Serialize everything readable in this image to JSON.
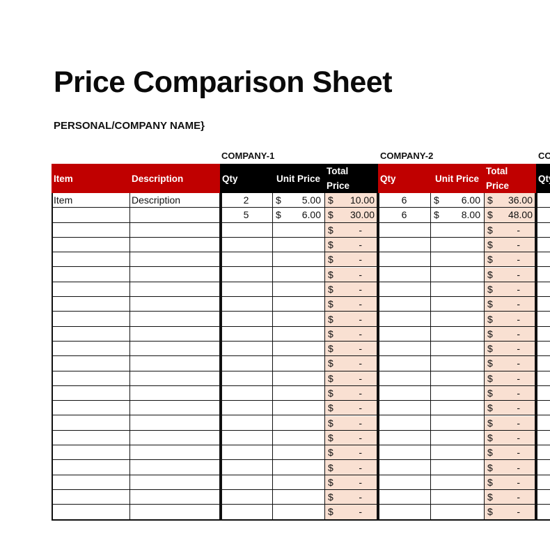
{
  "document": {
    "title": "Price Comparison Sheet",
    "subtitle": "PERSONAL/COMPANY NAME}"
  },
  "columns": {
    "item": "Item",
    "description": "Description",
    "qty": "Qty",
    "unit_price": "Unit Price",
    "total_price_line1": "Total",
    "total_price_line2": "Price"
  },
  "companies": [
    {
      "name": "COMPANY-1",
      "header_color": "#000000"
    },
    {
      "name": "COMPANY-2",
      "header_color": "#c00000"
    },
    {
      "name": "CO",
      "header_color": "#000000"
    }
  ],
  "colors": {
    "accent_red": "#c00000",
    "header_black": "#000000",
    "total_fill": "#f9e0d2"
  },
  "currency_symbol": "$",
  "empty_total": "-",
  "rows": [
    {
      "item": "Item",
      "description": "Description",
      "c1": {
        "qty": "2",
        "unit_price": "5.00",
        "total": "10.00"
      },
      "c2": {
        "qty": "6",
        "unit_price": "6.00",
        "total": "36.00"
      }
    },
    {
      "item": "",
      "description": "",
      "c1": {
        "qty": "5",
        "unit_price": "6.00",
        "total": "30.00"
      },
      "c2": {
        "qty": "6",
        "unit_price": "8.00",
        "total": "48.00"
      }
    },
    {
      "item": "",
      "description": "",
      "c1": {
        "qty": "",
        "unit_price": "",
        "total": "-"
      },
      "c2": {
        "qty": "",
        "unit_price": "",
        "total": "-"
      }
    },
    {
      "item": "",
      "description": "",
      "c1": {
        "qty": "",
        "unit_price": "",
        "total": "-"
      },
      "c2": {
        "qty": "",
        "unit_price": "",
        "total": "-"
      }
    },
    {
      "item": "",
      "description": "",
      "c1": {
        "qty": "",
        "unit_price": "",
        "total": "-"
      },
      "c2": {
        "qty": "",
        "unit_price": "",
        "total": "-"
      }
    },
    {
      "item": "",
      "description": "",
      "c1": {
        "qty": "",
        "unit_price": "",
        "total": "-"
      },
      "c2": {
        "qty": "",
        "unit_price": "",
        "total": "-"
      }
    },
    {
      "item": "",
      "description": "",
      "c1": {
        "qty": "",
        "unit_price": "",
        "total": "-"
      },
      "c2": {
        "qty": "",
        "unit_price": "",
        "total": "-"
      }
    },
    {
      "item": "",
      "description": "",
      "c1": {
        "qty": "",
        "unit_price": "",
        "total": "-"
      },
      "c2": {
        "qty": "",
        "unit_price": "",
        "total": "-"
      }
    },
    {
      "item": "",
      "description": "",
      "c1": {
        "qty": "",
        "unit_price": "",
        "total": "-"
      },
      "c2": {
        "qty": "",
        "unit_price": "",
        "total": "-"
      }
    },
    {
      "item": "",
      "description": "",
      "c1": {
        "qty": "",
        "unit_price": "",
        "total": "-"
      },
      "c2": {
        "qty": "",
        "unit_price": "",
        "total": "-"
      }
    },
    {
      "item": "",
      "description": "",
      "c1": {
        "qty": "",
        "unit_price": "",
        "total": "-"
      },
      "c2": {
        "qty": "",
        "unit_price": "",
        "total": "-"
      }
    },
    {
      "item": "",
      "description": "",
      "c1": {
        "qty": "",
        "unit_price": "",
        "total": "-"
      },
      "c2": {
        "qty": "",
        "unit_price": "",
        "total": "-"
      }
    },
    {
      "item": "",
      "description": "",
      "c1": {
        "qty": "",
        "unit_price": "",
        "total": "-"
      },
      "c2": {
        "qty": "",
        "unit_price": "",
        "total": "-"
      }
    },
    {
      "item": "",
      "description": "",
      "c1": {
        "qty": "",
        "unit_price": "",
        "total": "-"
      },
      "c2": {
        "qty": "",
        "unit_price": "",
        "total": "-"
      }
    },
    {
      "item": "",
      "description": "",
      "c1": {
        "qty": "",
        "unit_price": "",
        "total": "-"
      },
      "c2": {
        "qty": "",
        "unit_price": "",
        "total": "-"
      }
    },
    {
      "item": "",
      "description": "",
      "c1": {
        "qty": "",
        "unit_price": "",
        "total": "-"
      },
      "c2": {
        "qty": "",
        "unit_price": "",
        "total": "-"
      }
    },
    {
      "item": "",
      "description": "",
      "c1": {
        "qty": "",
        "unit_price": "",
        "total": "-"
      },
      "c2": {
        "qty": "",
        "unit_price": "",
        "total": "-"
      }
    },
    {
      "item": "",
      "description": "",
      "c1": {
        "qty": "",
        "unit_price": "",
        "total": "-"
      },
      "c2": {
        "qty": "",
        "unit_price": "",
        "total": "-"
      }
    },
    {
      "item": "",
      "description": "",
      "c1": {
        "qty": "",
        "unit_price": "",
        "total": "-"
      },
      "c2": {
        "qty": "",
        "unit_price": "",
        "total": "-"
      }
    },
    {
      "item": "",
      "description": "",
      "c1": {
        "qty": "",
        "unit_price": "",
        "total": "-"
      },
      "c2": {
        "qty": "",
        "unit_price": "",
        "total": "-"
      }
    },
    {
      "item": "",
      "description": "",
      "c1": {
        "qty": "",
        "unit_price": "",
        "total": "-"
      },
      "c2": {
        "qty": "",
        "unit_price": "",
        "total": "-"
      }
    },
    {
      "item": "",
      "description": "",
      "c1": {
        "qty": "",
        "unit_price": "",
        "total": "-"
      },
      "c2": {
        "qty": "",
        "unit_price": "",
        "total": "-"
      }
    }
  ]
}
